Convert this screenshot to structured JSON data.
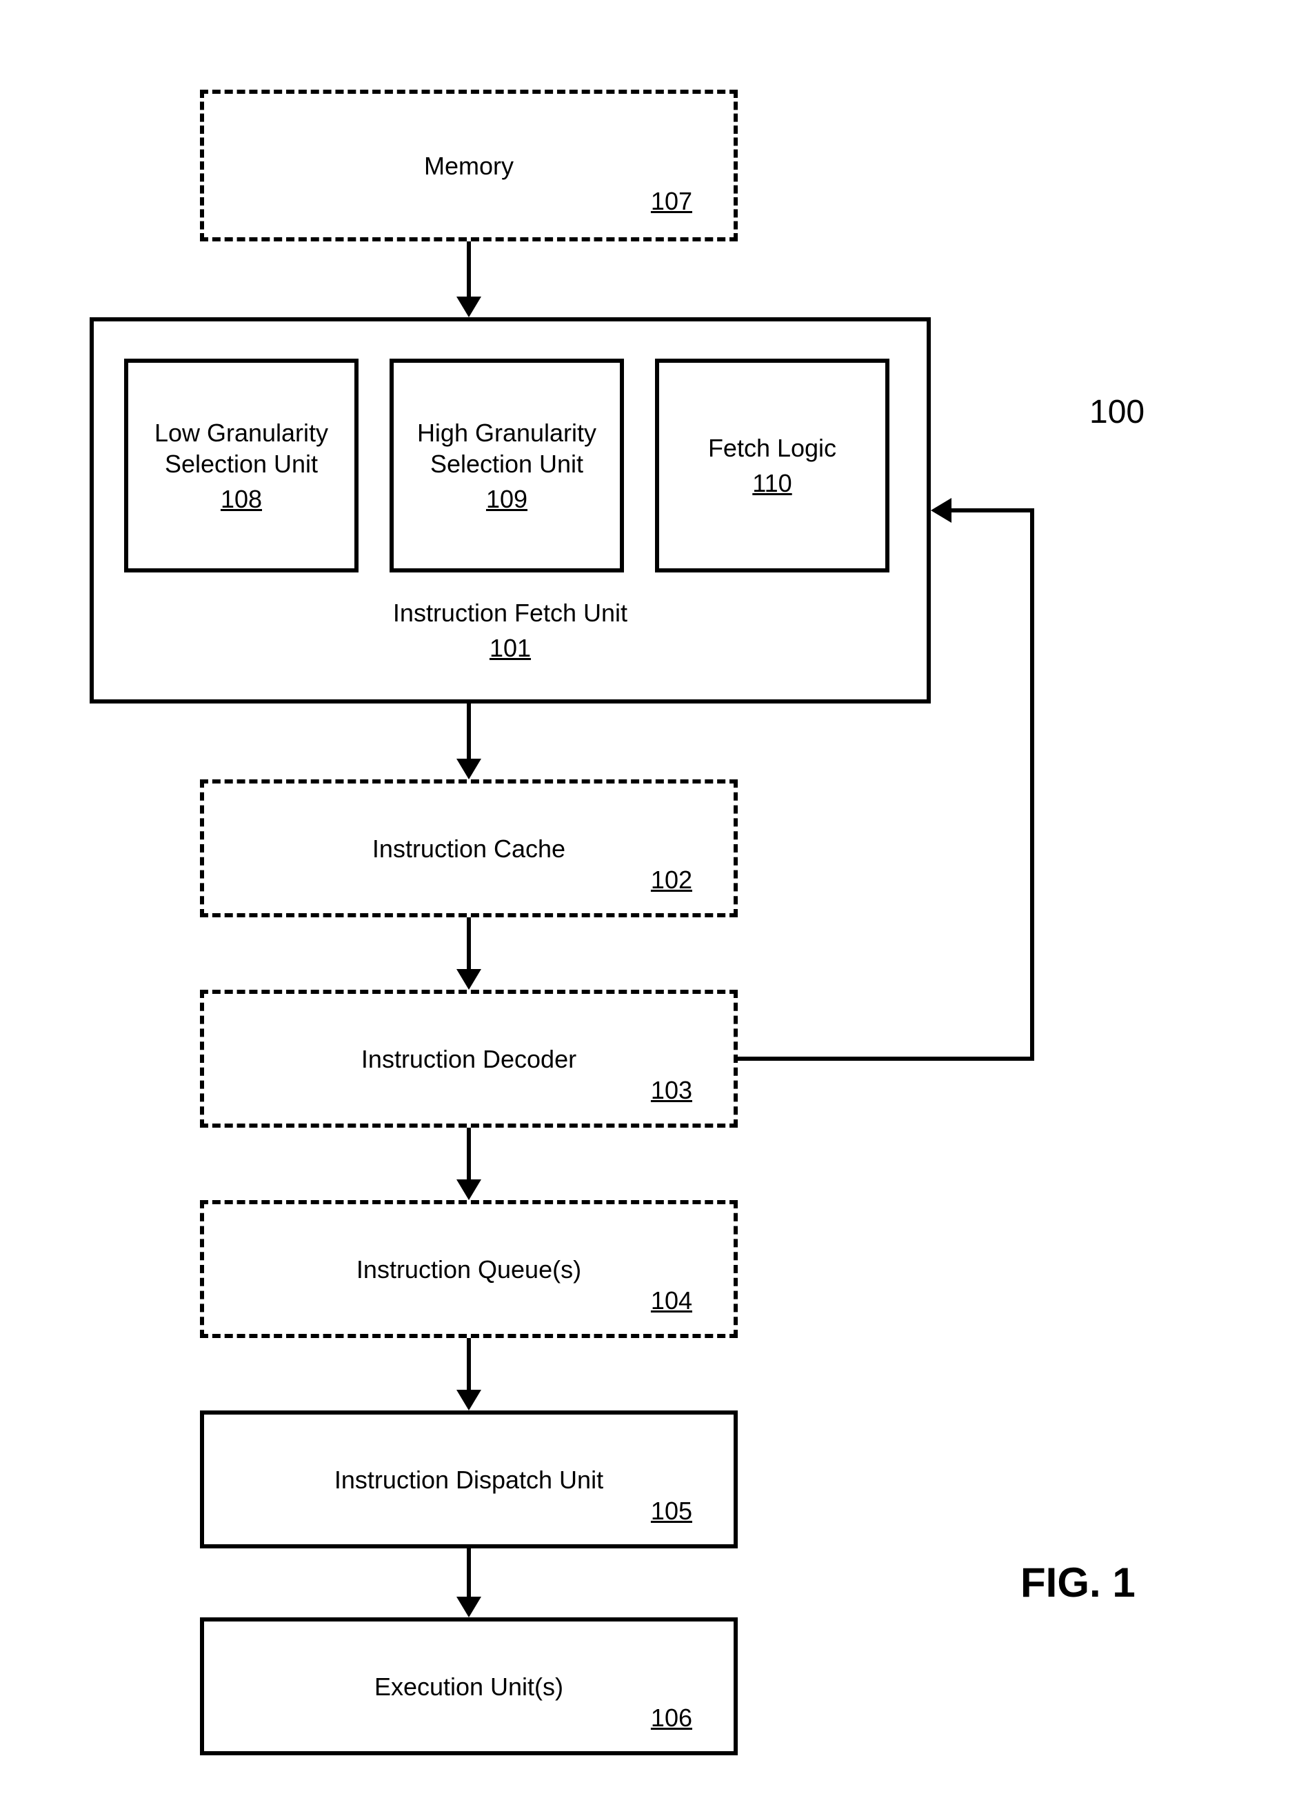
{
  "figure_ref": "100",
  "figure_label": "FIG. 1",
  "blocks": {
    "memory": {
      "label": "Memory",
      "ref": "107"
    },
    "ifu": {
      "label": "Instruction Fetch Unit",
      "ref": "101"
    },
    "low_gran": {
      "label": "Low Granularity Selection Unit",
      "ref": "108"
    },
    "high_gran": {
      "label": "High Granularity Selection Unit",
      "ref": "109"
    },
    "fetch_logic": {
      "label": "Fetch Logic",
      "ref": "110"
    },
    "icache": {
      "label": "Instruction Cache",
      "ref": "102"
    },
    "idecoder": {
      "label": "Instruction Decoder",
      "ref": "103"
    },
    "iqueue": {
      "label": "Instruction Queue(s)",
      "ref": "104"
    },
    "idispatch": {
      "label": "Instruction Dispatch Unit",
      "ref": "105"
    },
    "exec": {
      "label": "Execution Unit(s)",
      "ref": "106"
    }
  }
}
